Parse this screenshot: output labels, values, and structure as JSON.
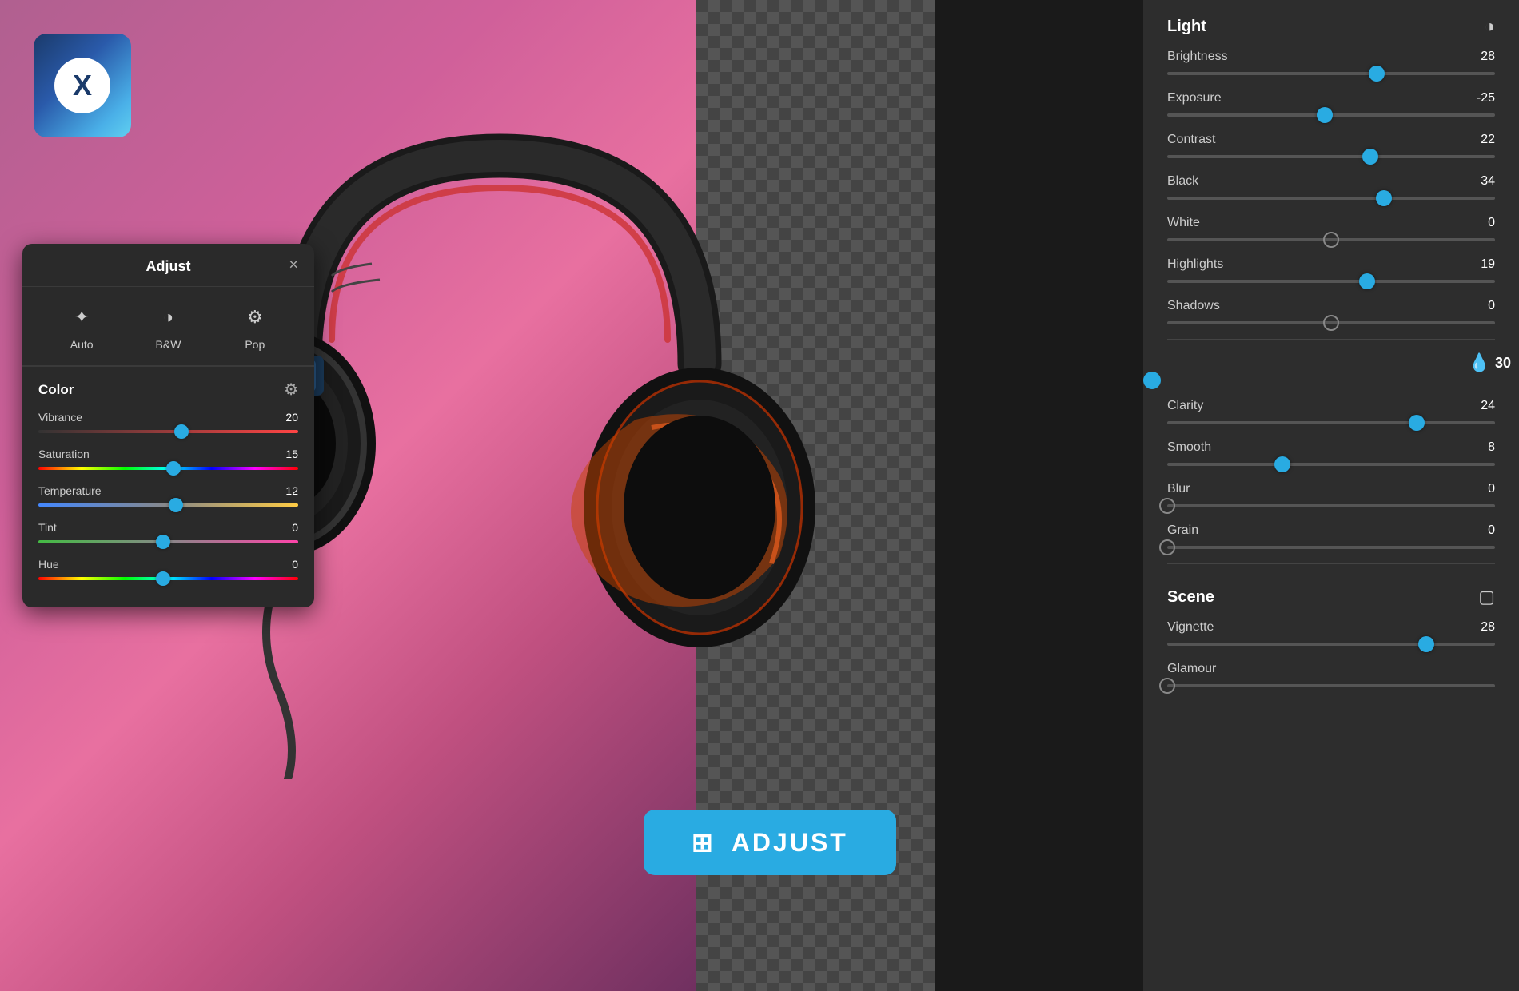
{
  "app": {
    "logo_letter": "X"
  },
  "adjust_panel": {
    "title": "Adjust",
    "close_btn": "×",
    "modes": [
      {
        "id": "auto",
        "label": "Auto",
        "icon": "✦"
      },
      {
        "id": "bw",
        "label": "B&W",
        "icon": "◑"
      },
      {
        "id": "pop",
        "label": "Pop",
        "icon": "⚙"
      }
    ],
    "color_section": {
      "title": "Color",
      "sliders": [
        {
          "label": "Vibrance",
          "value": 20,
          "percent": 55,
          "type": "vibrance"
        },
        {
          "label": "Saturation",
          "value": 15,
          "percent": 52,
          "type": "saturation"
        },
        {
          "label": "Temperature",
          "value": 12,
          "percent": 53,
          "type": "temperature"
        },
        {
          "label": "Tint",
          "value": 0,
          "percent": 48,
          "type": "tint"
        },
        {
          "label": "Hue",
          "value": 0,
          "percent": 48,
          "type": "hue"
        }
      ]
    }
  },
  "adjust_button": {
    "label": "ADJUST"
  },
  "right_panel": {
    "light_section": {
      "title": "Light",
      "sliders": [
        {
          "label": "Brightness",
          "value": 28,
          "percent": 64,
          "has_value": true
        },
        {
          "label": "Exposure",
          "value": -25,
          "percent": 48,
          "has_value": true
        },
        {
          "label": "Contrast",
          "value": 22,
          "percent": 62,
          "has_value": true
        },
        {
          "label": "Black",
          "value": 34,
          "percent": 66,
          "has_value": true
        },
        {
          "label": "White",
          "value": 0,
          "percent": 50,
          "has_value": true,
          "empty": true
        },
        {
          "label": "Highlights",
          "value": 19,
          "percent": 61,
          "has_value": true
        },
        {
          "label": "Shadows",
          "value": 0,
          "percent": 50,
          "has_value": true,
          "empty": true
        }
      ]
    },
    "detail_section": {
      "title": "",
      "scroll_value": 30,
      "sliders": [
        {
          "label": "Clarity",
          "value": 24,
          "percent": 76,
          "has_value": true
        },
        {
          "label": "Smooth",
          "value": 8,
          "percent": 35,
          "has_value": true
        },
        {
          "label": "Blur",
          "value": 0,
          "percent": 0,
          "has_value": true,
          "empty": true
        },
        {
          "label": "Grain",
          "value": 0,
          "percent": 0,
          "has_value": true,
          "empty": true
        }
      ]
    },
    "scene_section": {
      "title": "Scene",
      "sliders": [
        {
          "label": "Vignette",
          "value": 28,
          "percent": 79,
          "has_value": true
        },
        {
          "label": "Glamour",
          "value": "",
          "percent": 0,
          "has_value": false,
          "empty": true
        }
      ]
    }
  }
}
